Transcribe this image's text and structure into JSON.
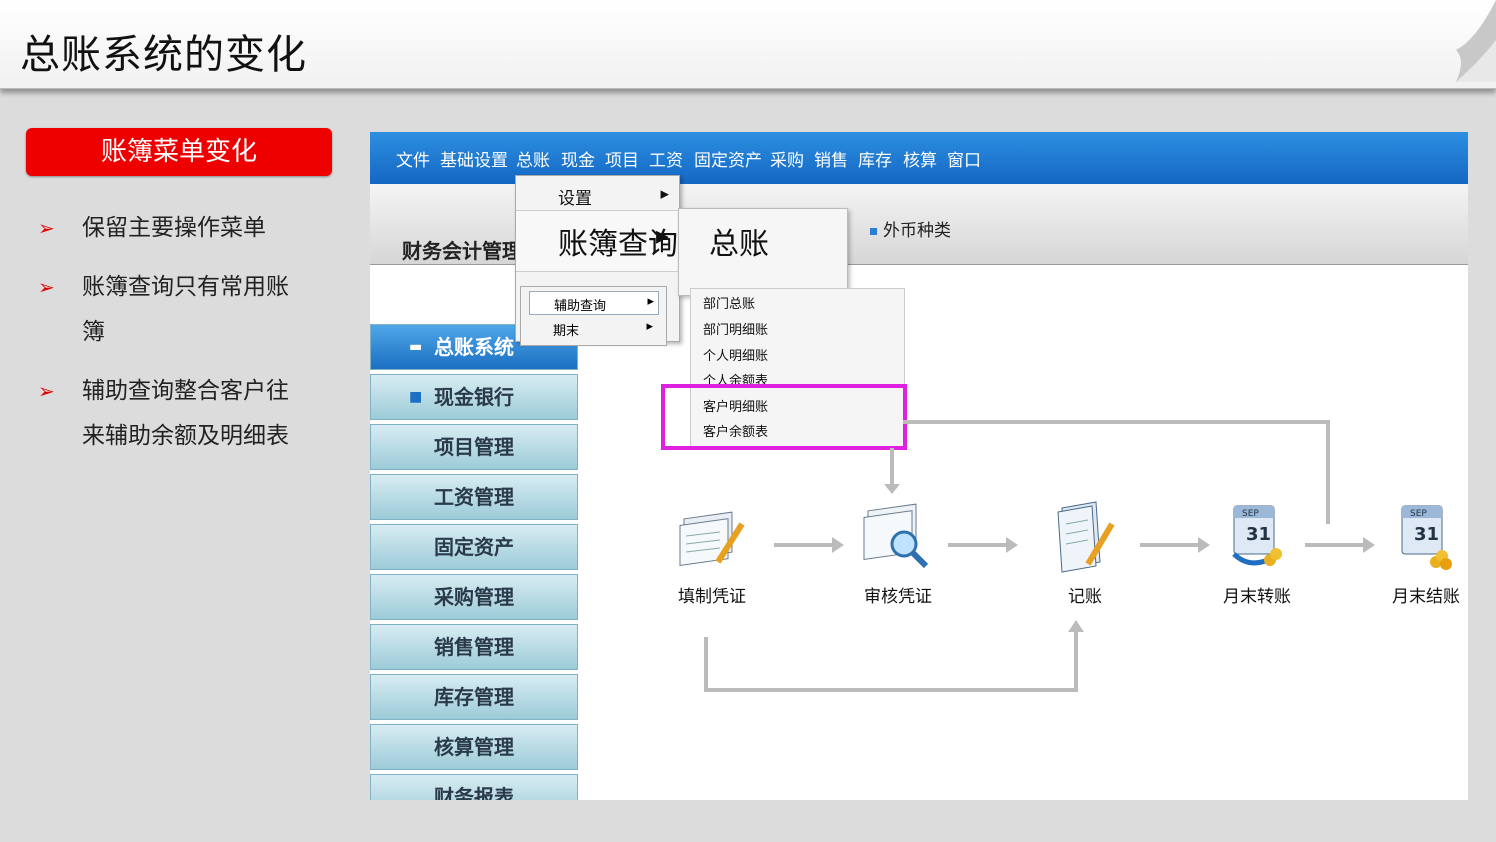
{
  "slide": {
    "title": "总账系统的变化",
    "button_label": "账簿菜单变化",
    "bullets": [
      {
        "line1": "保留主要操作菜单",
        "line2": ""
      },
      {
        "line1": "账簿查询只有常用账",
        "line2": "簿"
      },
      {
        "line1": "辅助查询整合客户往",
        "line2": "来辅助余额及明细表"
      }
    ],
    "bullet_mark": "➢"
  },
  "app": {
    "menu": [
      "文件",
      "基础设置",
      "总账",
      "现金",
      "项目",
      "工资",
      "固定资产",
      "采购",
      "销售",
      "库存",
      "核算",
      "窗口"
    ],
    "brand": "财务会计管理",
    "currency_link": "外币种类",
    "sidebar": [
      "总账系统",
      "现金银行",
      "项目管理",
      "工资管理",
      "固定资产",
      "采购管理",
      "销售管理",
      "库存管理",
      "核算管理",
      "财务报表"
    ],
    "dropdown": {
      "setup": "设置",
      "ledger_query": "账簿查询",
      "ledger_sub": "总账",
      "aux_query": "辅助查询",
      "period_end": "期末",
      "aux_items": [
        "部门总账",
        "部门明细账",
        "个人明细账",
        "个人余额表",
        "客户明细账",
        "客户余额表"
      ]
    },
    "flow": [
      "填制凭证",
      "审核凭证",
      "记账",
      "月末转账",
      "月末结账"
    ],
    "calendar_text": {
      "month": "SEP",
      "day": "31"
    },
    "colors": {
      "menubar": "#1a74cc",
      "highlight": "#e020e0",
      "button": "#ee0000"
    }
  }
}
